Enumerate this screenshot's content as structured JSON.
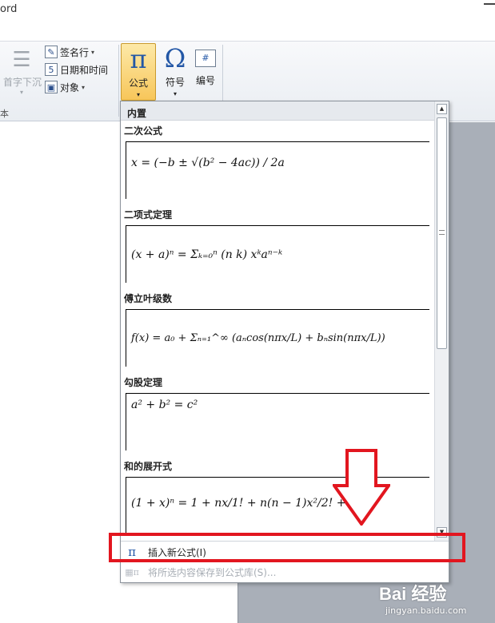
{
  "window": {
    "title_fragment": "ord"
  },
  "ribbon": {
    "dropcap_label": "首字下沉",
    "group_text_label": "本",
    "signature_label": "签名行",
    "datetime_label": "日期和时间",
    "object_label": "对象",
    "equation_label": "公式",
    "symbol_label": "符号",
    "number_label": "编号",
    "number_icon_glyph": "#"
  },
  "gallery": {
    "header": "内置",
    "sections": [
      {
        "title": "二次公式",
        "equation": "x = (−b ± √(b² − 4ac)) / 2a"
      },
      {
        "title": "二项式定理",
        "equation": "(x + a)ⁿ = Σₖ₌₀ⁿ (n k) xᵏaⁿ⁻ᵏ"
      },
      {
        "title": "傅立叶级数",
        "equation": "f(x) = a₀ + Σₙ₌₁^∞ (aₙcos(nπx/L) + bₙsin(nπx/L))"
      },
      {
        "title": "勾股定理",
        "equation": "a² + b² = c²"
      },
      {
        "title": "和的展开式",
        "equation": "(1 + x)ⁿ = 1 + nx/1! + n(n − 1)x²/2! + ⋯"
      }
    ],
    "insert_new_label": "插入新公式(I)",
    "save_selection_label": "将所选内容保存到公式库(S)..."
  },
  "watermark": {
    "brand": "Bai 经验",
    "site": "jingyan.baidu.com"
  },
  "colors": {
    "annotation_red": "#e2161f",
    "active_button": "#f7c65a",
    "accent_blue": "#2357a6"
  }
}
